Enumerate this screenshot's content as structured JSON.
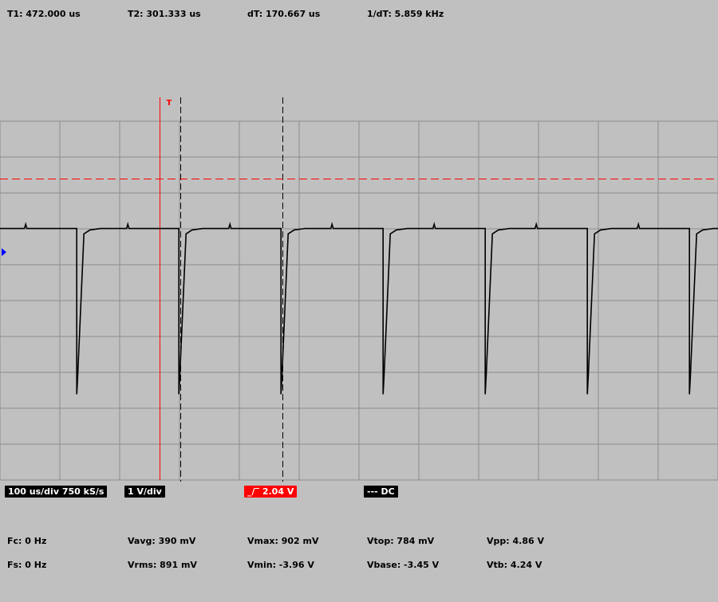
{
  "cursors": {
    "t1": "T1: 472.000 us",
    "t2": "T2: 301.333 us",
    "dt": "dT: 170.667 us",
    "inv_dt": "1/dT: 5.859 kHz"
  },
  "trigger_marker": "T",
  "status": {
    "timebase": "100 us/div 750 kS/s",
    "vdiv": "1 V/div",
    "trigger_level": "_/‾ 2.04 V",
    "coupling": "--- DC"
  },
  "measurements": {
    "fc": "Fc: 0 Hz",
    "fs": "Fs: 0 Hz",
    "vavg": "Vavg: 390 mV",
    "vrms": "Vrms: 891 mV",
    "vmax": "Vmax: 902 mV",
    "vmin": "Vmin: -3.96 V",
    "vtop": "Vtop: 784 mV",
    "vbase": "Vbase: -3.45 V",
    "vpp": "Vpp: 4.86 V",
    "vtb": "Vtb: 4.24 V"
  },
  "colors": {
    "background": "#c0c0c0",
    "grid": "#8c8c8c",
    "trace": "#000000",
    "trigger": "#ff0000",
    "ground_marker": "#0000ff"
  },
  "chart_data": {
    "type": "line",
    "x_unit": "us",
    "y_unit": "V",
    "divisions": {
      "x": 12,
      "y": 10
    },
    "time_per_div_us": 100,
    "volts_per_div": 1,
    "xlim_us": [
      -267,
      933
    ],
    "ylim_v": [
      -6.35,
      3.65
    ],
    "grid": true,
    "trigger_time_us": 0,
    "trigger_level_v": 2.04,
    "cursor_times_us": [
      34.7,
      205.3
    ],
    "pulse_period_us": 170.667,
    "first_pulse_us": -138.7,
    "v_high": 0.66,
    "v_base": -3.45,
    "v_min": -3.96,
    "v_max": 0.9
  }
}
